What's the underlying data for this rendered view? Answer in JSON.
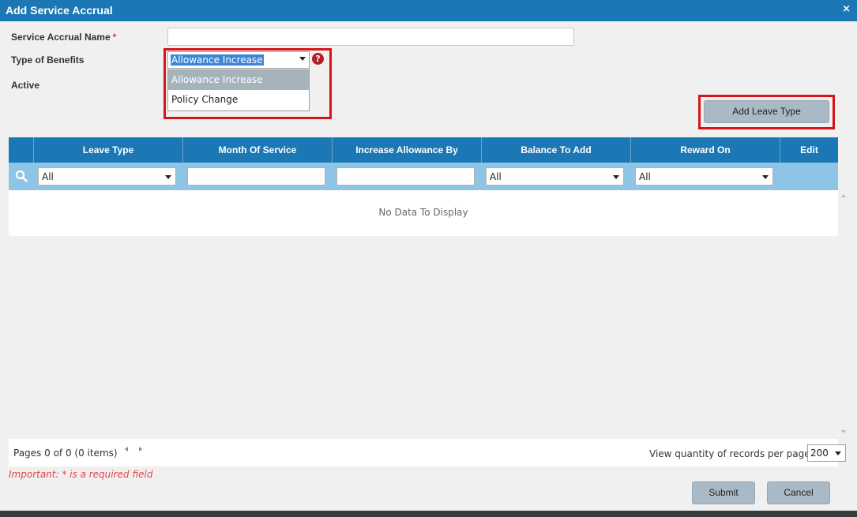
{
  "window": {
    "title": "Add Service Accrual",
    "close_label": "×"
  },
  "form": {
    "name_label": "Service Accrual Name",
    "required_mark": "*",
    "type_label": "Type of Benefits",
    "active_label": "Active",
    "type_select": {
      "selected": "Allowance Increase",
      "options": [
        "Allowance Increase",
        "Policy Change"
      ]
    },
    "help_icon": "?"
  },
  "toolbar": {
    "add_leave_type": "Add Leave Type"
  },
  "grid": {
    "columns": [
      "Leave Type",
      "Month Of Service",
      "Increase Allowance By",
      "Balance To Add",
      "Reward On",
      "Edit"
    ],
    "filters": {
      "leave_type": "All",
      "balance_to_add": "All",
      "reward_on": "All"
    },
    "empty_text": "No Data To Display"
  },
  "pager": {
    "info": "Pages 0 of 0 (0 items)",
    "qty_label": "View quantity of records per page",
    "qty_value": "200"
  },
  "footer": {
    "important": "Important: * is a required field",
    "submit": "Submit",
    "cancel": "Cancel"
  },
  "colors": {
    "header": "#1b78b4",
    "filter_row": "#8ec5e6",
    "highlight": "#d7141a",
    "button": "#a9bac6"
  }
}
